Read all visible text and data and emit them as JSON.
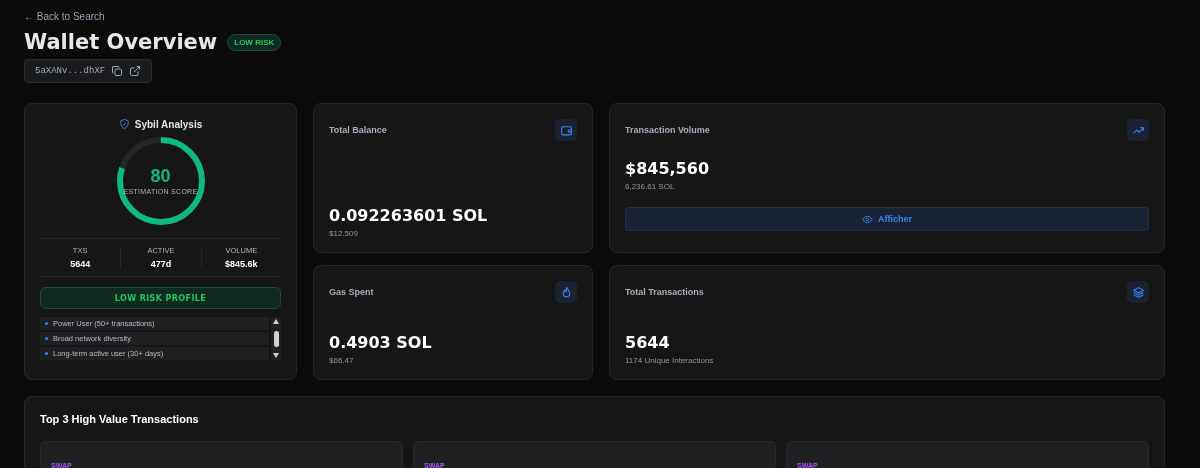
{
  "back_link": "← Back to Search",
  "title": "Wallet Overview",
  "risk_badge": "LOW RISK",
  "address": "5aXANv...dhXF",
  "sybil": {
    "title": "Sybil Analysis",
    "score": "80",
    "score_label": "ESTIMATION SCORE",
    "level": 0.8,
    "stats": [
      {
        "label": "TXS",
        "value": "5644"
      },
      {
        "label": "ACTIVE",
        "value": "477d"
      },
      {
        "label": "VOLUME",
        "value": "$845.6k"
      }
    ],
    "profile_button": "LOW RISK PROFILE",
    "signals": [
      "Power User (50+ transactions)",
      "Broad network diversity",
      "Long-term active user (30+ days)"
    ]
  },
  "cards": [
    {
      "title": "Total Balance",
      "value": "0.092263601 SOL",
      "sub": "$12.509"
    },
    {
      "title": "Transaction Volume",
      "value": "$845,560",
      "sub": "6,236.61 SOL",
      "button": "Afficher"
    },
    {
      "title": "Gas Spent",
      "value": "0.4903 SOL",
      "sub": "$66.47"
    },
    {
      "title": "Total Transactions",
      "value": "5644",
      "sub": "1174 Unique Interactions"
    }
  ],
  "top_transactions": {
    "title": "Top 3 High Value Transactions",
    "items": [
      {
        "type": "SWAP"
      },
      {
        "type": "SWAP"
      },
      {
        "type": "SWAP"
      }
    ]
  }
}
